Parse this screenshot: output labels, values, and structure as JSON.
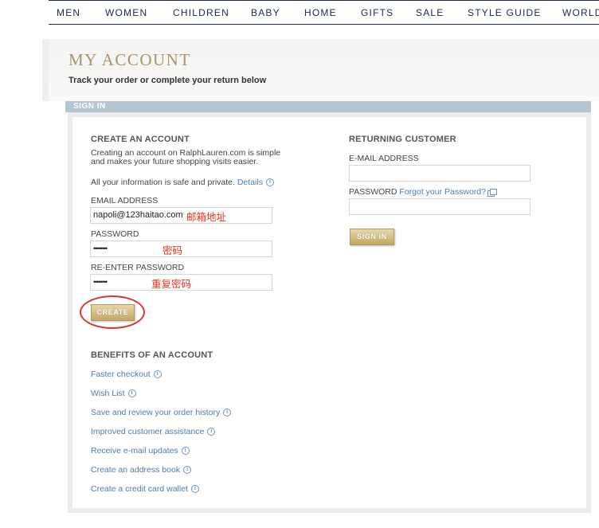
{
  "nav": {
    "items": [
      "MEN",
      "WOMEN",
      "CHILDREN",
      "BABY",
      "HOME",
      "GIFTS",
      "SALE",
      "STYLE GUIDE",
      "WORLD"
    ]
  },
  "header": {
    "title": "MY ACCOUNT",
    "subtitle": "Track your order or complete your return below"
  },
  "signin_bar": {
    "label": "SIGN IN"
  },
  "create_account": {
    "heading": "CREATE AN ACCOUNT",
    "description": "Creating an account on RalphLauren.com is simple and makes your future shopping visits easier.",
    "safe_text": "All your information is safe and private.",
    "details_link": "Details",
    "email_label": "EMAIL ADDRESS",
    "email_value": "napoli@123haitao.com",
    "password_label": "PASSWORD",
    "password_value": "••••••••",
    "reenter_label": "RE-ENTER PASSWORD",
    "reenter_value": "••••••••",
    "create_button": "CREATE"
  },
  "annotations": {
    "email_note": "邮箱地址",
    "password_note": "密码",
    "reenter_note": "重复密码"
  },
  "returning_customer": {
    "heading": "RETURNING CUSTOMER",
    "email_label": "E-MAIL ADDRESS",
    "email_value": "",
    "password_label": "PASSWORD",
    "forgot_link": "Forgot your Password?",
    "password_value": "",
    "signin_button": "SIGN IN"
  },
  "benefits": {
    "heading": "BENEFITS OF AN ACCOUNT",
    "items": [
      "Faster checkout",
      "Wish List",
      "Save and review your order history",
      "Improved customer assistance",
      "Receive e-mail updates",
      "Create an address book",
      "Create a credit card wallet"
    ]
  },
  "colors": {
    "nav_text": "#1d2a44",
    "title_gold": "#a8936a",
    "link_blue": "#4e7ea9",
    "signin_bar": "#b5c6d3",
    "annotation_red": "#e0331e"
  },
  "icons": {
    "info": "info-icon",
    "popup": "popup-window-icon"
  }
}
